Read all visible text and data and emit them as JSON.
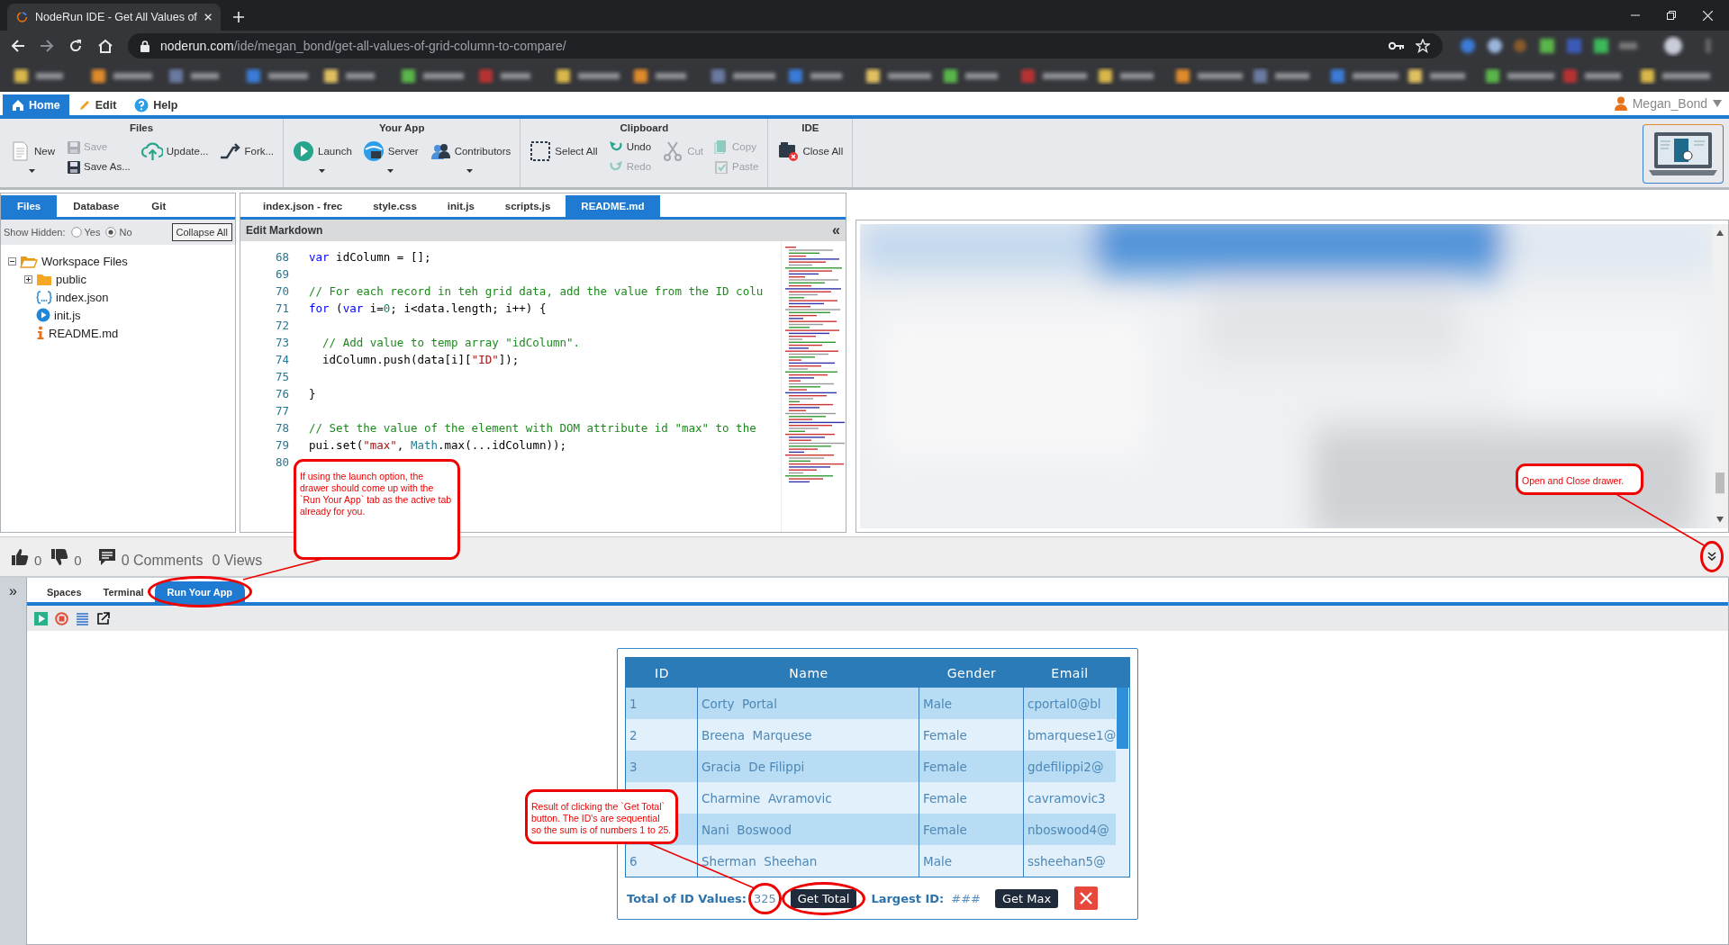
{
  "browser": {
    "tab_title": "NodeRun IDE - Get All Values of",
    "url_host": "noderun.com",
    "url_path": "/ide/megan_bond/get-all-values-of-grid-column-to-compare/"
  },
  "menu": [
    {
      "label": "Home",
      "selected": true
    },
    {
      "label": "Edit",
      "selected": false
    },
    {
      "label": "Help",
      "selected": false
    }
  ],
  "user": "Megan_Bond",
  "ribbon": [
    {
      "title": "Files",
      "columns": [
        [
          {
            "label": "New",
            "disabled": false,
            "dropdown": true
          }
        ],
        [
          {
            "label": "Save",
            "disabled": true,
            "dropdown": false
          },
          {
            "label": "Save As...",
            "disabled": false,
            "dropdown": false
          }
        ],
        [
          {
            "label": "Update...",
            "disabled": false,
            "dropdown": false
          }
        ],
        [
          {
            "label": "Fork...",
            "disabled": false,
            "dropdown": false
          }
        ]
      ]
    },
    {
      "title": "Your App",
      "columns": [
        [
          {
            "label": "Launch",
            "disabled": false,
            "dropdown": true
          }
        ],
        [
          {
            "label": "Server",
            "disabled": false,
            "dropdown": true
          }
        ],
        [
          {
            "label": "Contributors",
            "disabled": false,
            "dropdown": true
          }
        ]
      ]
    },
    {
      "title": "Clipboard",
      "columns": [
        [
          {
            "label": "Select All",
            "disabled": false,
            "dropdown": false
          }
        ],
        [
          {
            "label": "Undo",
            "disabled": false,
            "dropdown": false
          },
          {
            "label": "Redo",
            "disabled": true,
            "dropdown": false
          }
        ],
        [
          {
            "label": "Cut",
            "disabled": true,
            "dropdown": false
          }
        ],
        [
          {
            "label": "Copy",
            "disabled": true,
            "dropdown": false
          },
          {
            "label": "Paste",
            "disabled": true,
            "dropdown": false
          }
        ]
      ]
    },
    {
      "title": "IDE",
      "columns": [
        [
          {
            "label": "Close All",
            "disabled": false,
            "dropdown": false
          }
        ]
      ]
    }
  ],
  "left_tabs": [
    {
      "label": "Files",
      "selected": true
    },
    {
      "label": "Database",
      "selected": false
    },
    {
      "label": "Git",
      "selected": false
    }
  ],
  "show_hidden": {
    "label": "Show Hidden:",
    "options": [
      {
        "label": "Yes",
        "selected": false
      },
      {
        "label": "No",
        "selected": true
      }
    ]
  },
  "collapse_all": "Collapse All",
  "file_tree": [
    {
      "label": "Workspace Files",
      "kind": "folder",
      "expanded": true,
      "children": [
        {
          "label": "public",
          "kind": "folder",
          "expanded": false
        },
        {
          "label": "index.json",
          "kind": "json"
        },
        {
          "label": "init.js",
          "kind": "script"
        },
        {
          "label": "README.md",
          "kind": "info"
        }
      ]
    }
  ],
  "editor_tabs": [
    {
      "label": "index.json - frec",
      "selected": false
    },
    {
      "label": "style.css",
      "selected": false
    },
    {
      "label": "init.js",
      "selected": false
    },
    {
      "label": "scripts.js",
      "selected": false
    },
    {
      "label": "README.md",
      "selected": true
    }
  ],
  "editor": {
    "title": "Edit Markdown",
    "collapse": "«",
    "lines": [
      {
        "number": "68",
        "tokens": [
          {
            "kind": "keyword",
            "text": "var"
          },
          {
            "kind": "plain",
            "text": " idColumn = [];"
          }
        ]
      },
      {
        "number": "69"
      },
      {
        "number": "70",
        "tokens": [
          {
            "kind": "comment",
            "text": "// For each record in teh grid data, add the value from the ID colu"
          }
        ]
      },
      {
        "number": "71",
        "tokens": [
          {
            "kind": "keyword",
            "text": "for"
          },
          {
            "kind": "plain",
            "text": " ("
          },
          {
            "kind": "keyword",
            "text": "var"
          },
          {
            "kind": "plain",
            "text": " i="
          },
          {
            "kind": "number",
            "text": "0"
          },
          {
            "kind": "plain",
            "text": "; i<data.length; i++) {"
          }
        ]
      },
      {
        "number": "72"
      },
      {
        "number": "73",
        "tokens": [
          {
            "kind": "comment",
            "text": "  // Add value to temp array \"idColumn\"."
          }
        ]
      },
      {
        "number": "74",
        "tokens": [
          {
            "kind": "plain",
            "text": "  idColumn.push(data[i]["
          },
          {
            "kind": "string",
            "text": "\"ID\""
          },
          {
            "kind": "plain",
            "text": "]);"
          }
        ]
      },
      {
        "number": "75"
      },
      {
        "number": "76",
        "tokens": [
          {
            "kind": "plain",
            "text": "}"
          }
        ]
      },
      {
        "number": "77"
      },
      {
        "number": "78",
        "tokens": [
          {
            "kind": "comment",
            "text": "// Set the value of the element with DOM attribute id \"max\" to the"
          }
        ]
      },
      {
        "number": "79",
        "tokens": [
          {
            "kind": "plain",
            "text": "pui.set("
          },
          {
            "kind": "string",
            "text": "\"max\""
          },
          {
            "kind": "plain",
            "text": ", "
          },
          {
            "kind": "builtin",
            "text": "Math"
          },
          {
            "kind": "plain",
            "text": ".max(...idColumn));"
          }
        ]
      },
      {
        "number": "80"
      }
    ]
  },
  "stats": {
    "likes": "0",
    "dislikes": "0",
    "comments": "0 Comments",
    "views": "0 Views"
  },
  "drawer": {
    "toggle": "»",
    "tabs": [
      {
        "label": "Spaces",
        "selected": false
      },
      {
        "label": "Terminal",
        "selected": false
      },
      {
        "label": "Run Your App",
        "selected": true
      }
    ],
    "grid": {
      "columns": [
        "ID",
        "Name",
        "Gender",
        "Email"
      ],
      "rows": [
        {
          "id": "1",
          "name": "Corty  Portal",
          "gender": "Male",
          "email": "cportal0@bl"
        },
        {
          "id": "2",
          "name": "Breena  Marquese",
          "gender": "Female",
          "email": "bmarquese1@"
        },
        {
          "id": "3",
          "name": "Gracia  De Filippi",
          "gender": "Female",
          "email": "gdefilippi2@"
        },
        {
          "name": "Charmine  Avramovic",
          "gender": "Female",
          "email": "cavramovic3"
        },
        {
          "name": "Nani  Boswood",
          "gender": "Female",
          "email": "nboswood4@"
        },
        {
          "id": "6",
          "name": "Sherman  Sheehan",
          "gender": "Male",
          "email": "ssheehan5@"
        }
      ]
    },
    "total_label": "Total of ID Values:",
    "total_value": "325",
    "get_total": "Get Total",
    "largest_label": "Largest ID:",
    "largest_value": "###",
    "get_max": "Get Max"
  },
  "annotations": [
    {
      "text": "If using the launch option, the drawer should come up with the `Run Your App` tab as the active tab already for you."
    },
    {
      "text": "Result of clicking the `Get Total` button. The ID's are sequential so the sum is of numbers 1 to 25."
    },
    {
      "text": "Open and Close drawer."
    }
  ]
}
